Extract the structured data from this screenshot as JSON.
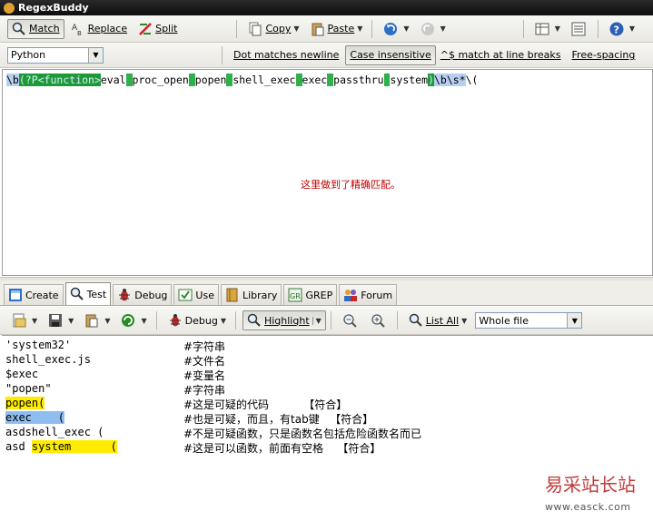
{
  "window": {
    "title": "RegexBuddy"
  },
  "toolbar1": {
    "match_label": "Match",
    "replace_label": "Replace",
    "split_label": "Split",
    "copy_label": "Copy",
    "paste_label": "Paste"
  },
  "toolbar2": {
    "flavor": "Python",
    "dot_newline": "Dot matches newline",
    "case_insensitive": "Case insensitive",
    "caret_dollar": "^$ match at line breaks",
    "free_spacing": "Free-spacing"
  },
  "regex": {
    "parts": [
      "\\b",
      "(?P<function>",
      "eval",
      "|",
      "proc_open",
      "|",
      "popen",
      "|",
      "shell_exec",
      "|",
      "exec",
      "|",
      "passthru",
      "|",
      "system",
      ")",
      "\\b\\s*",
      "\\("
    ]
  },
  "annotation": "这里做到了精确匹配。",
  "tabs": [
    "Create",
    "Test",
    "Debug",
    "Use",
    "Library",
    "GREP",
    "Forum"
  ],
  "toolbar3": {
    "debug_label": "Debug",
    "highlight_label": "Highlight",
    "list_all_label": "List All",
    "scope": "Whole file"
  },
  "test_lines": [
    {
      "text": "'system32'",
      "comment": "#字符串"
    },
    {
      "text": "shell_exec.js",
      "comment": "#文件名"
    },
    {
      "text": "$exec",
      "comment": "#变量名"
    },
    {
      "text": "\"popen\"",
      "comment": "#字符串"
    },
    {
      "text": "popen(",
      "comment": "#这是可疑的代码          【符合】"
    },
    {
      "text_a": "exec",
      "text_b": "    (",
      "comment": "#也是可疑，而且，有tab键   【符合】"
    },
    {
      "text": "asdshell_exec (",
      "comment": "#不是可疑函数，只是函数名包括危险函数名而已"
    },
    {
      "text_pre": "asd ",
      "text_a": "system",
      "text_b": "      (",
      "comment": "#这是可以函数，前面有空格    【符合】"
    }
  ],
  "watermark": {
    "name": "易采站长站",
    "url": "www.easck.com"
  },
  "colors": {
    "highlight_yellow": "#ffec00",
    "highlight_blue": "#8fbdf0",
    "group_green": "#1b9a36",
    "annotation_red": "#c00000"
  }
}
